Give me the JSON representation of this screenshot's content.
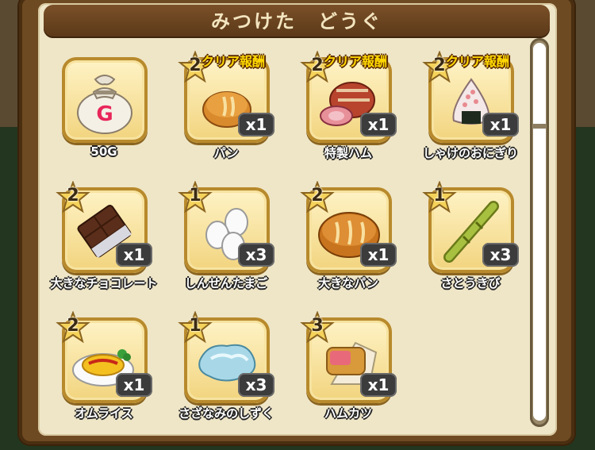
{
  "title": "みつけた　どうぐ",
  "items": [
    {
      "name": "50G",
      "stars": "",
      "quantity": "",
      "reward": "",
      "icon": "gold-bag-icon"
    },
    {
      "name": "パン",
      "stars": "2",
      "quantity": "x1",
      "reward": "クリア報酬",
      "icon": "bread-icon"
    },
    {
      "name": "特製ハム",
      "stars": "2",
      "quantity": "x1",
      "reward": "クリア報酬",
      "icon": "ham-icon"
    },
    {
      "name": "しゃけのおにぎり",
      "stars": "2",
      "quantity": "x1",
      "reward": "クリア報酬",
      "icon": "onigiri-icon"
    },
    {
      "name": "大きなチョコレート",
      "stars": "2",
      "quantity": "x1",
      "reward": "",
      "icon": "chocolate-icon"
    },
    {
      "name": "しんせんたまご",
      "stars": "1",
      "quantity": "x3",
      "reward": "",
      "icon": "eggs-icon"
    },
    {
      "name": "大きなパン",
      "stars": "2",
      "quantity": "x1",
      "reward": "",
      "icon": "big-bread-icon"
    },
    {
      "name": "さとうきび",
      "stars": "1",
      "quantity": "x3",
      "reward": "",
      "icon": "sugarcane-icon"
    },
    {
      "name": "オムライス",
      "stars": "2",
      "quantity": "x1",
      "reward": "",
      "icon": "omurice-icon"
    },
    {
      "name": "さざなみのしずく",
      "stars": "1",
      "quantity": "x3",
      "reward": "",
      "icon": "water-drop-icon"
    },
    {
      "name": "ハムカツ",
      "stars": "3",
      "quantity": "x1",
      "reward": "",
      "icon": "ham-cutlet-icon"
    }
  ],
  "colors": {
    "gold_g": "#e8265a",
    "reward_text": "#ffd800"
  }
}
